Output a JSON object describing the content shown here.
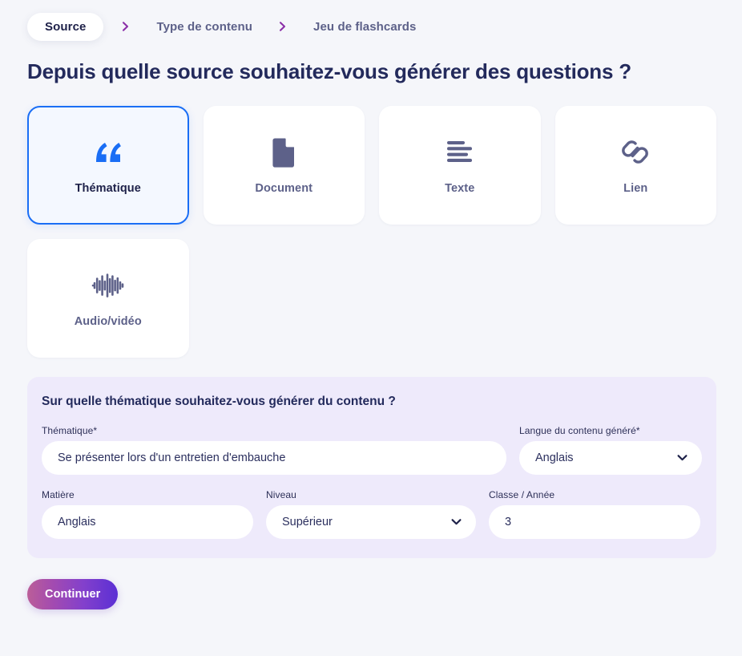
{
  "breadcrumb": {
    "separator_icon": "chevron-right-icon",
    "steps": [
      {
        "label": "Source",
        "active": true
      },
      {
        "label": "Type de contenu",
        "active": false
      },
      {
        "label": "Jeu de flashcards",
        "active": false
      }
    ]
  },
  "page_title": "Depuis quelle source souhaitez-vous générer des questions ?",
  "source_cards": [
    {
      "label": "Thématique",
      "icon": "quote-icon",
      "selected": true
    },
    {
      "label": "Document",
      "icon": "document-icon",
      "selected": false
    },
    {
      "label": "Texte",
      "icon": "text-lines-icon",
      "selected": false
    },
    {
      "label": "Lien",
      "icon": "link-icon",
      "selected": false
    },
    {
      "label": "Audio/vidéo",
      "icon": "waveform-icon",
      "selected": false
    }
  ],
  "form": {
    "title": "Sur quelle thématique souhaitez-vous générer du contenu ?",
    "fields": {
      "thematique": {
        "label": "Thématique*",
        "value": "Se présenter lors d'un entretien d'embauche",
        "placeholder": "Se présenter lors d'un entretien d'embauche"
      },
      "langue": {
        "label": "Langue du contenu généré*",
        "value": "Anglais",
        "chevron_icon": "chevron-down-icon"
      },
      "matiere": {
        "label": "Matière",
        "value": "Anglais",
        "placeholder": "Anglais"
      },
      "niveau": {
        "label": "Niveau",
        "value": "Supérieur",
        "chevron_icon": "chevron-down-icon"
      },
      "classe": {
        "label": "Classe / Année",
        "value": "3",
        "placeholder": "3"
      }
    }
  },
  "actions": {
    "continue_label": "Continuer"
  },
  "colors": {
    "page_background": "#f5f6fa",
    "panel_background": "#eeeafb",
    "selected_border": "#1a6ef5",
    "selected_background": "#f4f8ff",
    "title_navy": "#232a5c",
    "muted_slate": "#5d6189",
    "separator_purple": "#8b2fa8",
    "button_gradient_start": "#bb5e98",
    "button_gradient_end": "#5b2fd4"
  }
}
